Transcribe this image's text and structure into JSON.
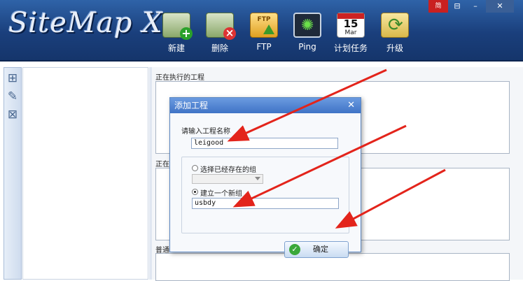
{
  "app": {
    "logo_text": "SiteMap X"
  },
  "toolbar": {
    "new_label": "新建",
    "delete_label": "删除",
    "ftp_label": "FTP",
    "ftp_icon_text": "FTP",
    "ping_label": "Ping",
    "schedule_label": "计划任务",
    "schedule_icon_day": "15",
    "schedule_icon_month": "Mar",
    "upgrade_label": "升级"
  },
  "window_controls": {
    "lang": "简",
    "restore": "⊟",
    "minimize": "–",
    "close": "✕"
  },
  "main": {
    "running_label": "正在执行的工程",
    "section2_label": "正在",
    "section3_label": "普通"
  },
  "dialog": {
    "title": "添加工程",
    "close": "✕",
    "name_label": "请输入工程名称",
    "name_value": "leigood",
    "radio_existing_label": "选择已经存在的组",
    "radio_new_label": "建立一个新组",
    "new_group_value": "usbdy",
    "ok_label": "确定"
  },
  "colors": {
    "header": "#1a3f7c",
    "dialog_title": "#3f73c6",
    "arrow": "#e3241b"
  }
}
